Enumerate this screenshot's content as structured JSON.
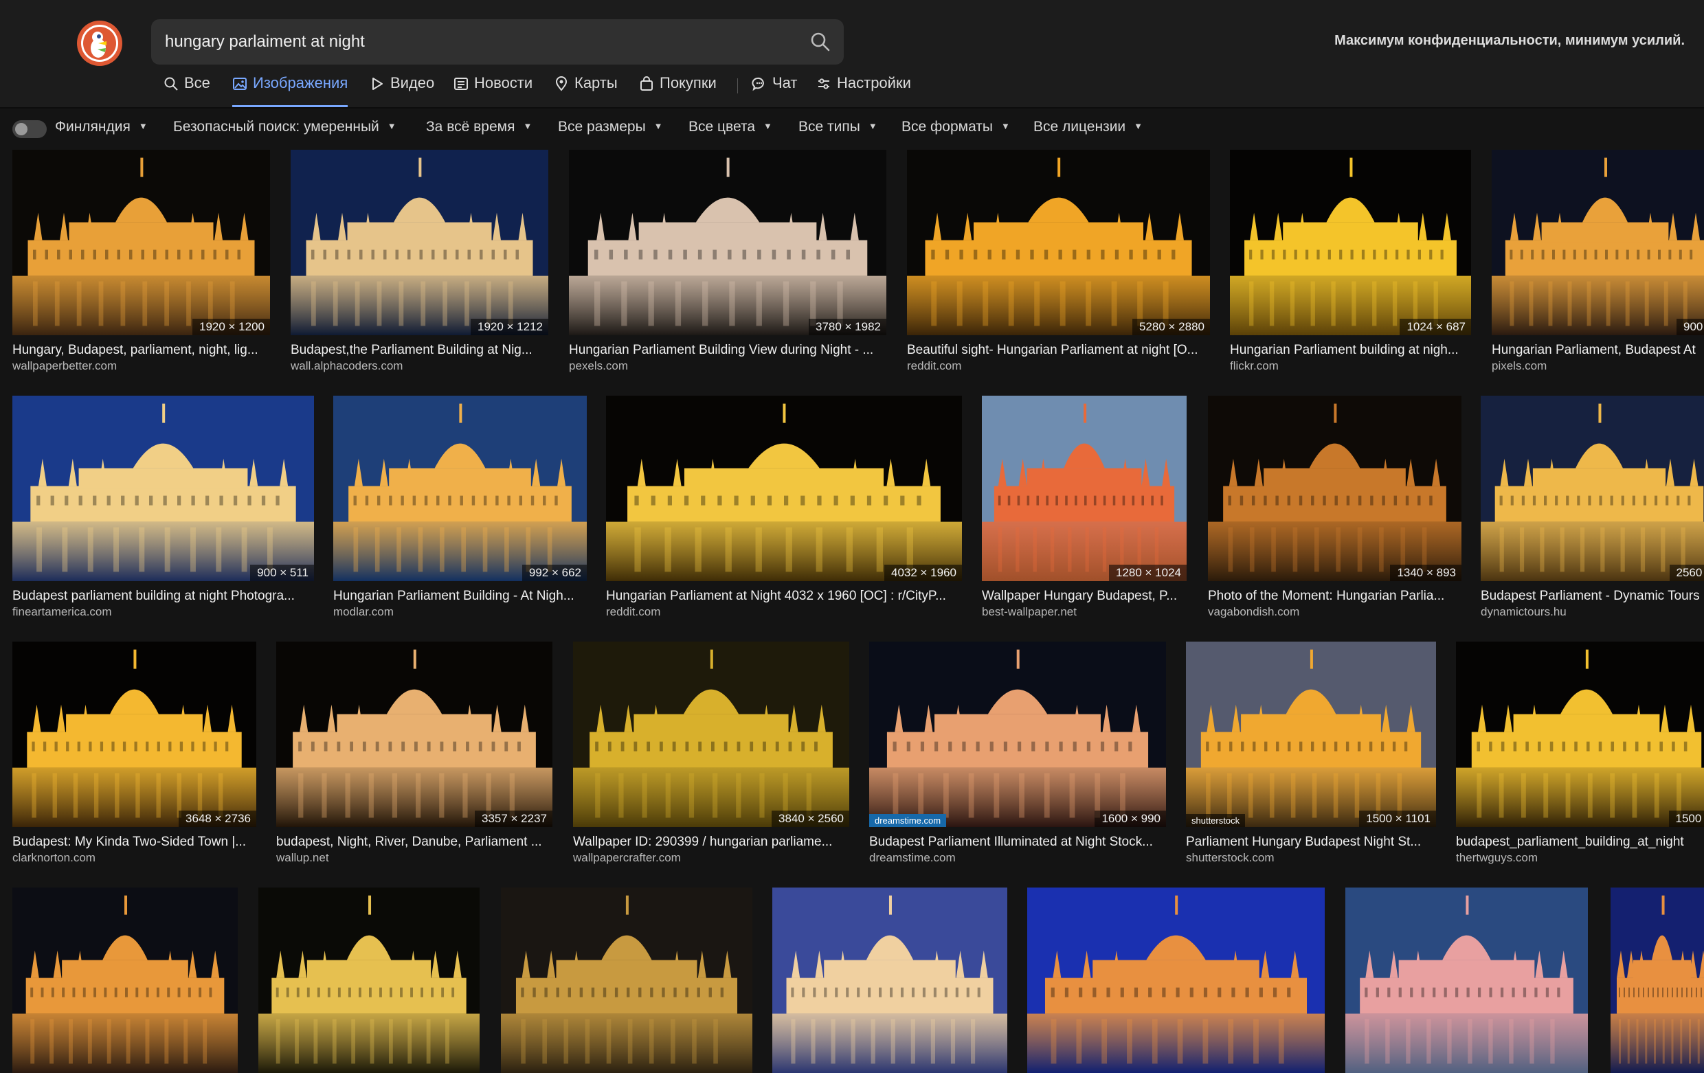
{
  "search": {
    "query": "hungary parlaiment at night"
  },
  "tagline": "Максимум конфиденциальности, минимум усилий.",
  "tabs": [
    {
      "label": "Все",
      "icon": "search-icon"
    },
    {
      "label": "Изображения",
      "icon": "image-icon",
      "active": true
    },
    {
      "label": "Видео",
      "icon": "play-icon"
    },
    {
      "label": "Новости",
      "icon": "newspaper-icon"
    },
    {
      "label": "Карты",
      "icon": "map-pin-icon"
    },
    {
      "label": "Покупки",
      "icon": "shopping-bag-icon"
    },
    {
      "label": "Чат",
      "icon": "chat-icon"
    },
    {
      "label": "Настройки",
      "icon": "settings-sliders-icon"
    }
  ],
  "filters": {
    "region": "Финляндия",
    "safe_search": "Безопасный поиск: умеренный",
    "time": "За всё время",
    "size": "Все размеры",
    "color": "Все цвета",
    "type": "Все типы",
    "format": "Все форматы",
    "license": "Все лицензии"
  },
  "colors": {
    "accent": "#79a8ff",
    "background": "#141414",
    "header": "#1c1c1c",
    "search_field": "#303030"
  },
  "results": [
    [
      {
        "caption": "Hungary, Budapest, parliament, night, lig...",
        "domain": "wallpaperbetter.com",
        "dims": "1920 × 1200",
        "sky": "#0b0906",
        "light": "#e8a038",
        "water": "#3a2410"
      },
      {
        "caption": "Budapest,the Parliament Building at Nig...",
        "domain": "wall.alphacoders.com",
        "dims": "1920 × 1212",
        "sky": "#10224e",
        "light": "#e6c48a",
        "water": "#0e1a33"
      },
      {
        "caption": "Hungarian Parliament Building View during Night - ...",
        "domain": "pexels.com",
        "dims": "3780 × 1982",
        "sky": "#0a0a0a",
        "light": "#d9c2ae",
        "water": "#1c1815"
      },
      {
        "caption": "Beautiful sight- Hungarian Parliament at night [O...",
        "domain": "reddit.com",
        "dims": "5280 × 2880",
        "sky": "#090806",
        "light": "#f0a526",
        "water": "#3a2408"
      },
      {
        "caption": "Hungarian Parliament building at nigh...",
        "domain": "flickr.com",
        "dims": "1024 × 687",
        "sky": "#050403",
        "light": "#f4c42a",
        "water": "#5a4008"
      },
      {
        "caption": "Hungarian Parliament, Budapest At",
        "domain": "pixels.com",
        "dims": "900 ×",
        "sky": "#0d1120",
        "light": "#e9a13a",
        "water": "#2a1a10"
      }
    ],
    [
      {
        "caption": "Budapest parliament building at night Photogra...",
        "domain": "fineartamerica.com",
        "dims": "900 × 511",
        "sky": "#1a3a8a",
        "light": "#f1cf86",
        "water": "#1c2c5a"
      },
      {
        "caption": "Hungarian Parliament Building - At Nigh...",
        "domain": "modlar.com",
        "dims": "992 × 662",
        "sky": "#1e3f78",
        "light": "#f0b04a",
        "water": "#123060"
      },
      {
        "caption": "Hungarian Parliament at Night 4032 x 1960 [OC] : r/CityP...",
        "domain": "reddit.com",
        "dims": "4032 × 1960",
        "sky": "#060503",
        "light": "#f2c640",
        "water": "#3e2c06"
      },
      {
        "caption": "Wallpaper Hungary Budapest, P...",
        "domain": "best-wallpaper.net",
        "dims": "1280 × 1024",
        "sky": "#6f8db0",
        "light": "#e86a3a",
        "water": "#a0502a"
      },
      {
        "caption": "Photo of the Moment: Hungarian Parlia...",
        "domain": "vagabondish.com",
        "dims": "1340 × 893",
        "sky": "#0e0a06",
        "light": "#c8782a",
        "water": "#2a1a0a"
      },
      {
        "caption": "Budapest Parliament - Dynamic Tours",
        "domain": "dynamictours.hu",
        "dims": "2560 ×",
        "sky": "#16213f",
        "light": "#eeb84a",
        "water": "#4a3310"
      }
    ],
    [
      {
        "caption": "Budapest: My Kinda Two-Sided Town |...",
        "domain": "clarknorton.com",
        "dims": "3648 × 2736",
        "sky": "#040302",
        "light": "#f4b830",
        "water": "#3a2408"
      },
      {
        "caption": "budapest, Night, River, Danube, Parliament ...",
        "domain": "wallup.net",
        "dims": "3357 × 2237",
        "sky": "#080604",
        "light": "#e8b070",
        "water": "#201408"
      },
      {
        "caption": "Wallpaper ID: 290399 / hungarian parliame...",
        "domain": "wallpapercrafter.com",
        "dims": "3840 × 2560",
        "sky": "#1e1a0a",
        "light": "#d8b02c",
        "water": "#4a3a08"
      },
      {
        "caption": "Budapest Parliament Illuminated at Night Stock...",
        "domain": "dreamstime.com",
        "dims": "1600 × 990",
        "sky": "#0a0d18",
        "light": "#e8a070",
        "water": "#2a1410",
        "badge": "dreamstime.com"
      },
      {
        "caption": "Parliament Hungary Budapest Night St...",
        "domain": "shutterstock.com",
        "dims": "1500 × 1101",
        "sky": "#555a6e",
        "light": "#f0a830",
        "water": "#3a2810",
        "badge": "shutterstock"
      },
      {
        "caption": "budapest_parliament_building_at_night",
        "domain": "thertwguys.com",
        "dims": "1500 ×",
        "sky": "#050403",
        "light": "#f2c030",
        "water": "#2e2006"
      }
    ],
    [
      {
        "sky": "#0c0d14",
        "light": "#e8983a",
        "water": "#2a1a10"
      },
      {
        "sky": "#0a0a06",
        "light": "#e6c050",
        "water": "#1a1808"
      },
      {
        "sky": "#1a1612",
        "light": "#c89a40",
        "water": "#2a2010"
      },
      {
        "sky": "#3a4a9a",
        "light": "#f0d0a0",
        "water": "#2a3570"
      },
      {
        "sky": "#1a30b0",
        "light": "#e89040",
        "water": "#102070"
      },
      {
        "sky": "#2a4a80",
        "light": "#e8a0a0",
        "water": "#506080"
      },
      {
        "sky": "#142070",
        "light": "#e89040",
        "water": "#101a50"
      }
    ]
  ]
}
